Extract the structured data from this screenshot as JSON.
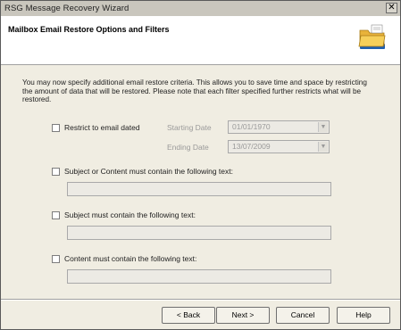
{
  "window": {
    "title": "RSG Message Recovery Wizard",
    "close_glyph": "✕"
  },
  "header": {
    "title": "Mailbox Email Restore Options and Filters",
    "icon": "folder-icon"
  },
  "intro_text": "You may now specify additional email restore criteria. This allows you to save time and space by restricting the amount of data that will be restored.  Please note that each filter specified further restricts what will be restored.",
  "date_filter": {
    "checkbox_label": "Restrict to email dated",
    "checked": false,
    "starting_label": "Starting Date",
    "starting_value": "01/01/1970",
    "ending_label": "Ending Date",
    "ending_value": "13/07/2009"
  },
  "subject_or_content_filter": {
    "checkbox_label": "Subject or Content must contain the following text:",
    "checked": false,
    "value": ""
  },
  "subject_filter": {
    "checkbox_label": "Subject must contain the following text:",
    "checked": false,
    "value": ""
  },
  "content_filter": {
    "checkbox_label": "Content must contain the following text:",
    "checked": false,
    "value": ""
  },
  "buttons": {
    "back": "< Back",
    "next": "Next >",
    "cancel": "Cancel",
    "help": "Help"
  },
  "colors": {
    "dialog_background": "#f0ede2",
    "titlebar": "#c9c6bd",
    "disabled_text": "#9a9a9a"
  }
}
